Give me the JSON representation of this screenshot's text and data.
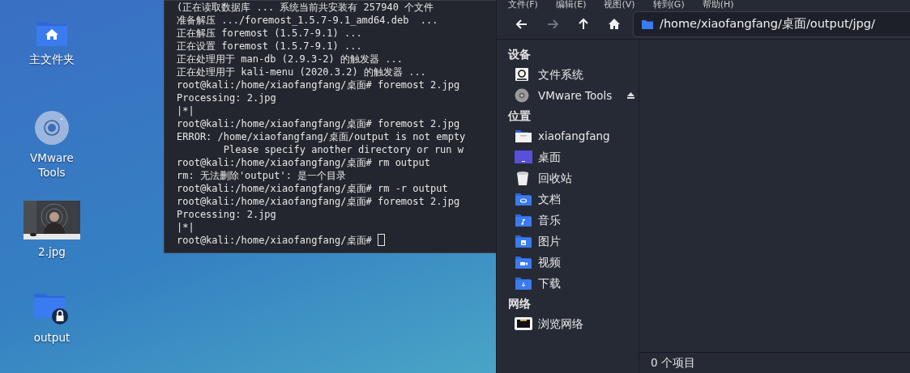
{
  "desktop": {
    "icons": [
      {
        "label": "主文件夹",
        "kind": "home-folder"
      },
      {
        "label": "VMware Tools",
        "kind": "disc"
      },
      {
        "label": "2.jpg",
        "kind": "picture"
      },
      {
        "label": "output",
        "kind": "locked-folder"
      }
    ]
  },
  "terminal": {
    "lines": [
      "(正在读取数据库 ... 系统当前共安装有 257940 个文件",
      "准备解压 .../foremost_1.5.7-9.1_amd64.deb  ...",
      "正在解压 foremost (1.5.7-9.1) ...",
      "正在设置 foremost (1.5.7-9.1) ...",
      "正在处理用于 man-db (2.9.3-2) 的触发器 ...",
      "正在处理用于 kali-menu (2020.3.2) 的触发器 ...",
      "root@kali:/home/xiaofangfang/桌面# foremost 2.jpg",
      "Processing: 2.jpg",
      "|*|",
      "root@kali:/home/xiaofangfang/桌面# foremost 2.jpg",
      "ERROR: /home/xiaofangfang/桌面/output is not empty",
      "        Please specify another directory or run w",
      "root@kali:/home/xiaofangfang/桌面# rm output",
      "rm: 无法删除'output': 是一个目录",
      "root@kali:/home/xiaofangfang/桌面# rm -r output",
      "root@kali:/home/xiaofangfang/桌面# foremost 2.jpg",
      "Processing: 2.jpg",
      "|*|",
      "root@kali:/home/xiaofangfang/桌面# "
    ],
    "cursor": true
  },
  "file_manager": {
    "menu": [
      "文件(F)",
      "编辑(E)",
      "视图(V)",
      "转到(G)",
      "帮助(H)"
    ],
    "nav": [
      {
        "kind": "back",
        "disabled": false
      },
      {
        "kind": "forward",
        "disabled": true
      },
      {
        "kind": "up",
        "disabled": false
      },
      {
        "kind": "home",
        "disabled": false
      }
    ],
    "location": "/home/xiaofangfang/桌面/output/jpg/",
    "sidebar": [
      {
        "title": "设备",
        "items": [
          {
            "label": "文件系统",
            "kind": "drive",
            "eject": false
          },
          {
            "label": "VMware Tools",
            "kind": "disc",
            "eject": true
          }
        ]
      },
      {
        "title": "位置",
        "items": [
          {
            "label": "xiaofangfang",
            "kind": "home",
            "eject": false
          },
          {
            "label": "桌面",
            "kind": "desktop",
            "eject": false
          },
          {
            "label": "回收站",
            "kind": "trash",
            "eject": false
          },
          {
            "label": "文档",
            "kind": "documents",
            "eject": false
          },
          {
            "label": "音乐",
            "kind": "music",
            "eject": false
          },
          {
            "label": "图片",
            "kind": "pictures",
            "eject": false
          },
          {
            "label": "视频",
            "kind": "videos",
            "eject": false
          },
          {
            "label": "下载",
            "kind": "downloads",
            "eject": false
          }
        ]
      },
      {
        "title": "网络",
        "items": [
          {
            "label": "浏览网络",
            "kind": "network",
            "eject": false
          }
        ]
      }
    ],
    "status": "0 个项目"
  }
}
